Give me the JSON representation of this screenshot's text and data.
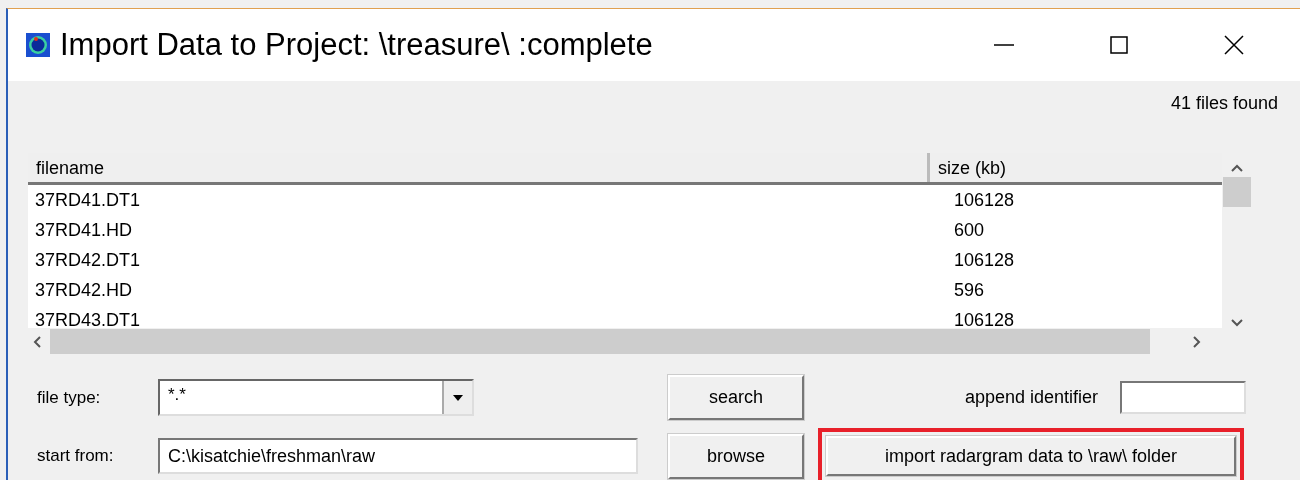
{
  "window": {
    "title": "Import Data to Project: \\treasure\\ :complete"
  },
  "file_count": "41 files found",
  "table": {
    "columns": [
      "filename",
      "size (kb)"
    ],
    "rows": [
      {
        "filename": "37RD41.DT1",
        "size": "106128"
      },
      {
        "filename": "37RD41.HD",
        "size": "600"
      },
      {
        "filename": "37RD42.DT1",
        "size": "106128"
      },
      {
        "filename": "37RD42.HD",
        "size": "596"
      },
      {
        "filename": "37RD43.DT1",
        "size": "106128"
      }
    ]
  },
  "file_type": {
    "label": "file type:",
    "value": "*.*"
  },
  "start_from": {
    "label": "start from:",
    "value": "C:\\kisatchie\\freshman\\raw"
  },
  "append_identifier": {
    "label": "append identifier"
  },
  "buttons": {
    "search": "search",
    "browse": "browse",
    "import": {
      "label": "import radargram data to \\raw\\ folder",
      "highlighted": true
    }
  }
}
